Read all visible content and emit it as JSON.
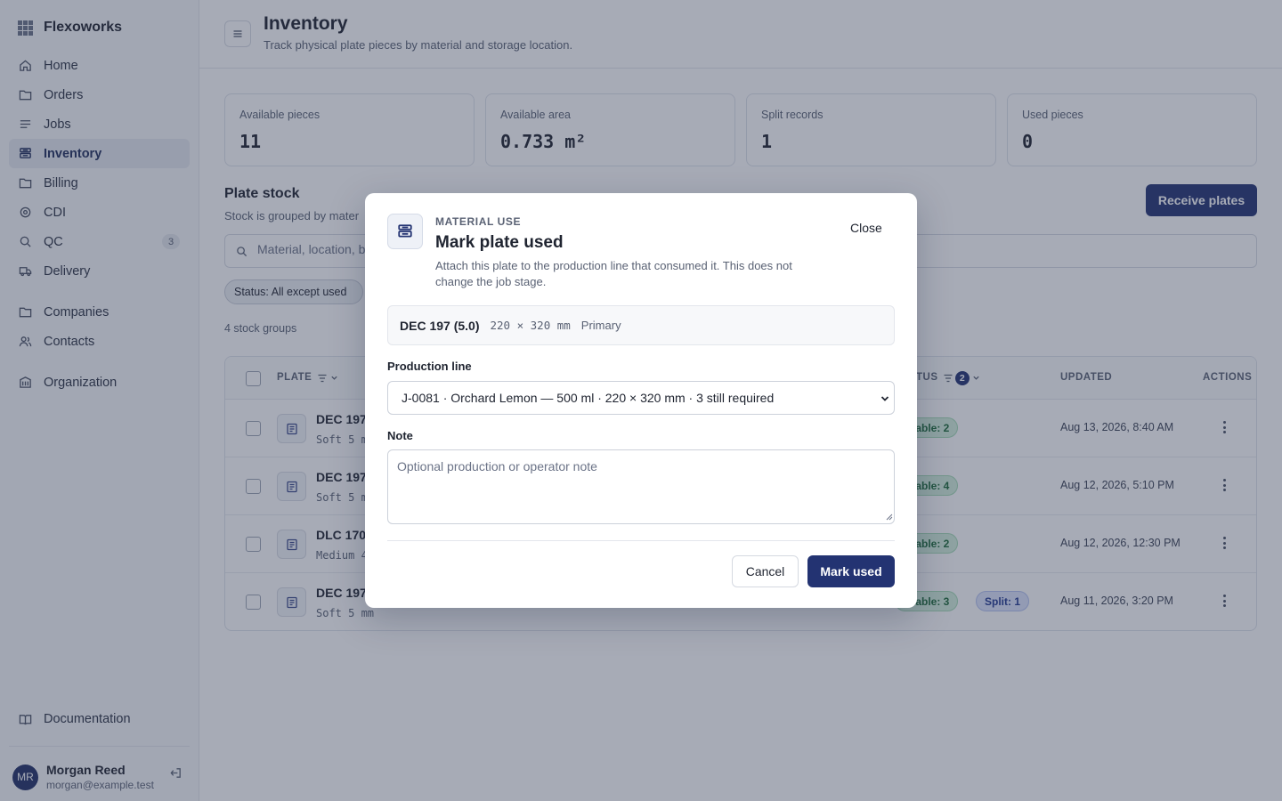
{
  "app": {
    "name": "Flexoworks"
  },
  "sidebar": {
    "items": [
      {
        "label": "Home",
        "icon": "home-icon"
      },
      {
        "label": "Orders",
        "icon": "folder-icon"
      },
      {
        "label": "Jobs",
        "icon": "list-icon"
      },
      {
        "label": "Inventory",
        "icon": "layers-icon",
        "active": true
      },
      {
        "label": "Billing",
        "icon": "folder-icon"
      },
      {
        "label": "CDI",
        "icon": "target-icon"
      },
      {
        "label": "QC",
        "icon": "search-icon",
        "badge": "3"
      },
      {
        "label": "Delivery",
        "icon": "truck-icon"
      }
    ],
    "secondary": [
      {
        "label": "Companies",
        "icon": "folder-icon"
      },
      {
        "label": "Contacts",
        "icon": "users-icon"
      }
    ],
    "tertiary": [
      {
        "label": "Organization",
        "icon": "building-icon"
      }
    ],
    "documentation": "Documentation",
    "user": {
      "initials": "MR",
      "name": "Morgan Reed",
      "email": "morgan@example.test"
    }
  },
  "header": {
    "title": "Inventory",
    "subtitle": "Track physical plate pieces by material and storage location."
  },
  "stats": [
    {
      "label": "Available pieces",
      "value": "11"
    },
    {
      "label": "Available area",
      "value": "0.733 m²"
    },
    {
      "label": "Split records",
      "value": "1"
    },
    {
      "label": "Used pieces",
      "value": "0"
    }
  ],
  "stock": {
    "title": "Plate stock",
    "subtitle": "Stock is grouped by mater",
    "receive_label": "Receive plates",
    "search_placeholder": "Material, location, b",
    "status_filter": "Status: All except used",
    "group_count": "4 stock groups",
    "columns": {
      "plate": "PLATE",
      "status": "TUS",
      "status_filter_count": "2",
      "updated": "UPDATED",
      "actions": "ACTIONS"
    },
    "rows": [
      {
        "name": "DEC 197",
        "sub": "Soft 5 m",
        "pills": [
          {
            "label": "ailable: 2",
            "tone": "green"
          }
        ],
        "updated": "Aug 13, 2026, 8:40 AM"
      },
      {
        "name": "DEC 197",
        "sub": "Soft 5 m",
        "pills": [
          {
            "label": "ailable: 4",
            "tone": "green"
          }
        ],
        "updated": "Aug 12, 2026, 5:10 PM"
      },
      {
        "name": "DLC 170",
        "sub": "Medium 4",
        "pills": [
          {
            "label": "ailable: 2",
            "tone": "green"
          }
        ],
        "updated": "Aug 12, 2026, 12:30 PM"
      },
      {
        "name": "DEC 197",
        "sub": "Soft 5 mm",
        "pills": [
          {
            "label": "ailable: 3",
            "tone": "green"
          },
          {
            "label": "Split: 1",
            "tone": "blue"
          }
        ],
        "updated": "Aug 11, 2026, 3:20 PM"
      }
    ]
  },
  "modal": {
    "eyebrow": "MATERIAL USE",
    "title": "Mark plate used",
    "description": "Attach this plate to the production line that consumed it. This does not change the job stage.",
    "close_label": "Close",
    "plate": {
      "name": "DEC 197 (5.0)",
      "dimensions": "220 × 320 mm",
      "kind": "Primary"
    },
    "production_line_label": "Production line",
    "production_line_value": "J-0081 · Orchard Lemon — 500 ml · 220 × 320 mm · 3 still required",
    "note_label": "Note",
    "note_placeholder": "Optional production or operator note",
    "cancel_label": "Cancel",
    "confirm_label": "Mark used"
  }
}
